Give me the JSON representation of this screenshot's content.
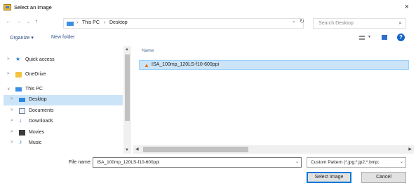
{
  "window": {
    "title": "Select an image",
    "close": "×"
  },
  "nav": {
    "back": "←",
    "forward": "→",
    "up": "↑",
    "breadcrumb": [
      "This PC",
      "Desktop"
    ],
    "dropdown": "⌄",
    "refresh": "↻",
    "search_placeholder": "Search Desktop",
    "search_icon": "⌕"
  },
  "toolbar": {
    "organize": "Organize ▾",
    "new_folder": "New folder",
    "help": "?"
  },
  "tree": {
    "items": [
      {
        "label": "Quick access",
        "icon": "star-icon",
        "expander": ">",
        "selected": false
      },
      {
        "label": "OneDrive",
        "icon": "folder-icon",
        "expander": ">",
        "selected": false
      },
      {
        "label": "This PC",
        "icon": "pc-icon",
        "expander": "∨",
        "selected": false
      },
      {
        "label": "Desktop",
        "icon": "desktop-icon",
        "expander": ">",
        "selected": true
      },
      {
        "label": "Documents",
        "icon": "documents-icon",
        "expander": ">",
        "selected": false
      },
      {
        "label": "Downloads",
        "icon": "download-icon",
        "expander": ">",
        "selected": false
      },
      {
        "label": "Movies",
        "icon": "movies-icon",
        "expander": ">",
        "selected": false
      },
      {
        "label": "Music",
        "icon": "music-icon",
        "expander": ">",
        "selected": false
      }
    ]
  },
  "content": {
    "column_header": "Name",
    "files": [
      {
        "name": "ISA_100mp_120LS-f10-600ppi",
        "icon": "image-file-icon",
        "selected": true
      }
    ]
  },
  "footer": {
    "file_name_label": "File name:",
    "file_name_value": "ISA_100mp_120LS-f10-600ppi",
    "filter_value": "Custom Pattern (*.jpg;*.jp2;*.bmp;",
    "select_button": "Select Image",
    "cancel_button": "Cancel"
  },
  "colors": {
    "selection": "#cce4f7",
    "accent": "#0078d7"
  }
}
